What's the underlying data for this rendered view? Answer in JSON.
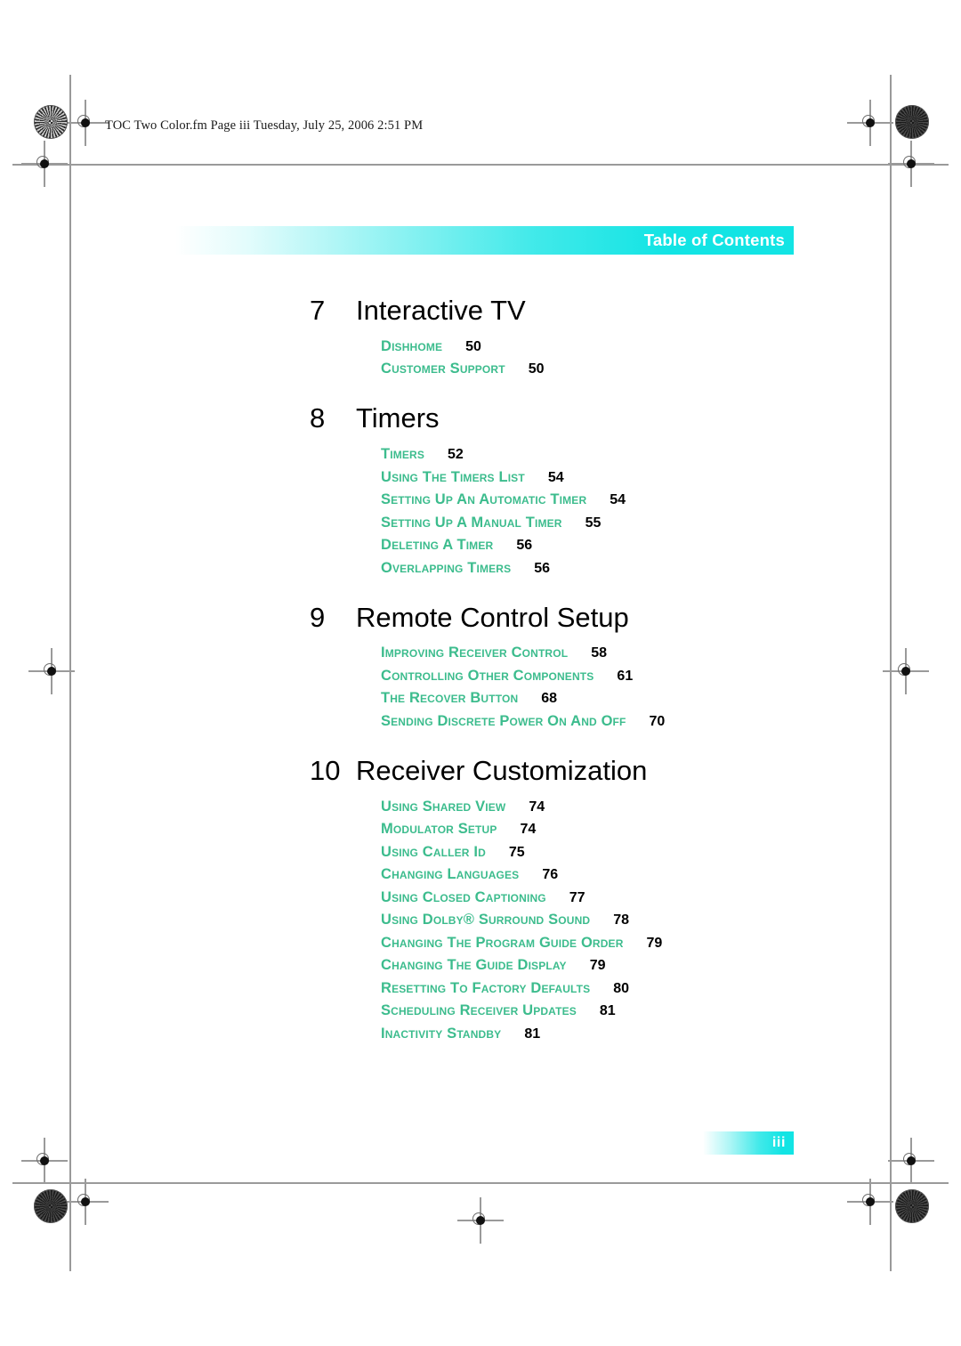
{
  "print_header": {
    "text": "TOC Two Color.fm  Page iii  Tuesday, July 25, 2006  2:51 PM"
  },
  "running_head": {
    "label": "Table of Contents"
  },
  "colors": {
    "banner_cyan": "#12E4E4",
    "entry_green": "#3CBC8D",
    "heading_black": "#000000",
    "page_number_black": "#000000"
  },
  "footer": {
    "page_number": "iii"
  },
  "toc": {
    "chapters": [
      {
        "number": "7",
        "title": "Interactive TV",
        "entries": [
          {
            "label": "DishHOME",
            "page": "50"
          },
          {
            "label": "Customer Support",
            "page": "50"
          }
        ]
      },
      {
        "number": "8",
        "title": "Timers",
        "entries": [
          {
            "label": "Timers",
            "page": "52"
          },
          {
            "label": "Using the Timers List",
            "page": "54"
          },
          {
            "label": "Setting Up an Automatic Timer",
            "page": "54"
          },
          {
            "label": "Setting Up a Manual Timer",
            "page": "55"
          },
          {
            "label": "Deleting a Timer",
            "page": "56"
          },
          {
            "label": "Overlapping Timers",
            "page": "56"
          }
        ]
      },
      {
        "number": "9",
        "title": "Remote Control Setup",
        "entries": [
          {
            "label": "Improving Receiver Control",
            "page": "58"
          },
          {
            "label": "Controlling Other Components",
            "page": "61"
          },
          {
            "label": "The Recover Button",
            "page": "68"
          },
          {
            "label": "Sending Discrete Power On and Off",
            "page": "70"
          }
        ]
      },
      {
        "number": "10",
        "title": "Receiver Customization",
        "entries": [
          {
            "label": "Using Shared View",
            "page": "74"
          },
          {
            "label": "Modulator Setup",
            "page": "74"
          },
          {
            "label": "Using Caller ID",
            "page": "75"
          },
          {
            "label": "Changing Languages",
            "page": "76"
          },
          {
            "label": "Using Closed Captioning",
            "page": "77"
          },
          {
            "label": "Using Dolby® Surround Sound",
            "page": "78"
          },
          {
            "label": "Changing the Program Guide Order",
            "page": "79"
          },
          {
            "label": "Changing the Guide Display",
            "page": "79"
          },
          {
            "label": "Resetting to Factory Defaults",
            "page": "80"
          },
          {
            "label": "Scheduling Receiver Updates",
            "page": "81"
          },
          {
            "label": "Inactivity Standby",
            "page": "81"
          }
        ]
      }
    ]
  }
}
